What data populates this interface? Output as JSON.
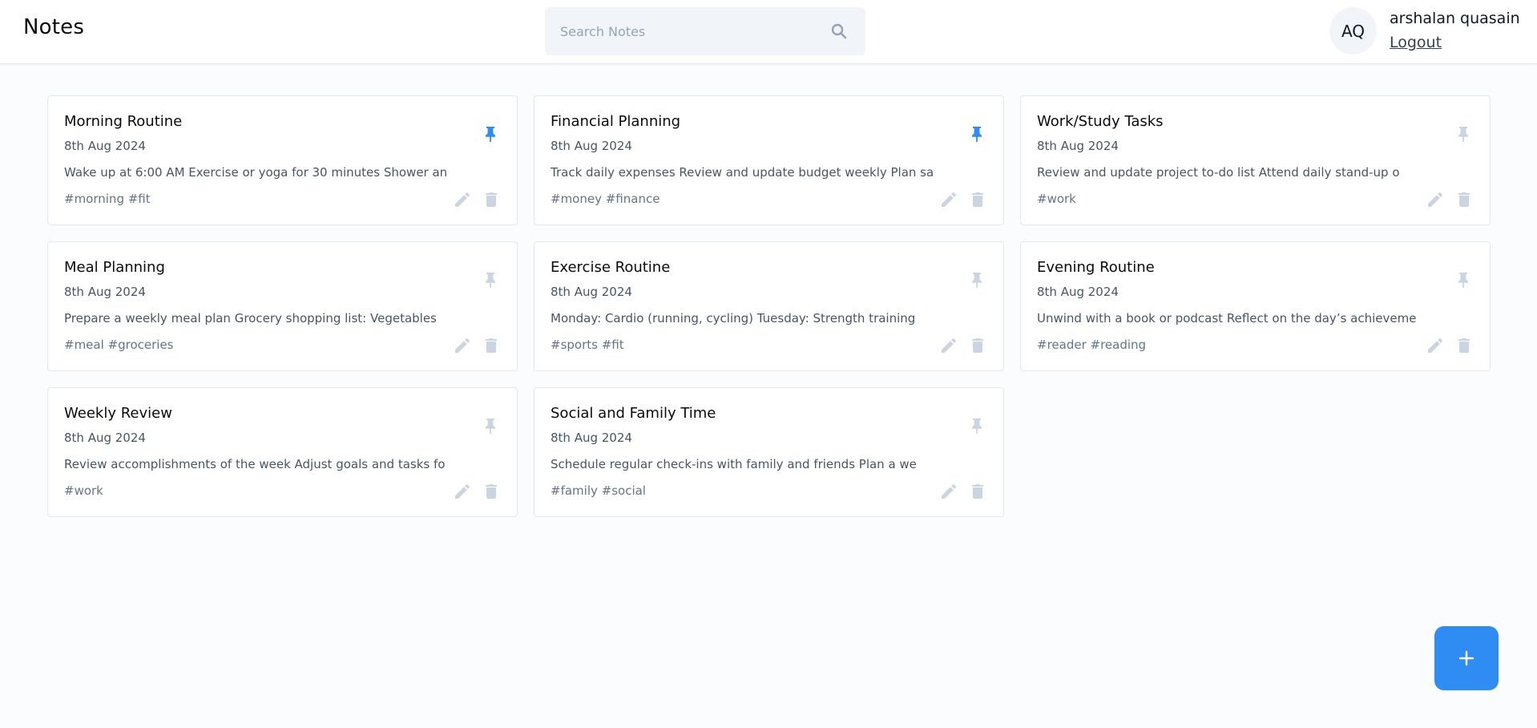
{
  "header": {
    "app_title": "Notes",
    "search_placeholder": "Search Notes",
    "user": {
      "initials": "AQ",
      "name": "arshalan quasain",
      "logout_label": "Logout"
    }
  },
  "colors": {
    "pinned": "#2f8cf2",
    "unpinned": "#cbd5e1",
    "action_icon": "#cbd5e1",
    "fab": "#2f8cf2"
  },
  "notes": [
    {
      "title": "Morning Routine",
      "date": "8th Aug 2024",
      "content": "Wake up at 6:00 AM Exercise or yoga for 30 minutes Shower an",
      "tags": "#morning #fit",
      "pinned": true
    },
    {
      "title": "Financial Planning",
      "date": "8th Aug 2024",
      "content": "Track daily expenses Review and update budget weekly Plan sa",
      "tags": "#money #finance",
      "pinned": true
    },
    {
      "title": "Work/Study Tasks",
      "date": "8th Aug 2024",
      "content": "Review and update project to-do list Attend daily stand-up o",
      "tags": "#work",
      "pinned": false
    },
    {
      "title": "Meal Planning",
      "date": "8th Aug 2024",
      "content": "Prepare a weekly meal plan Grocery shopping list: Vegetables",
      "tags": "#meal #groceries",
      "pinned": false
    },
    {
      "title": "Exercise Routine",
      "date": "8th Aug 2024",
      "content": "Monday: Cardio (running, cycling) Tuesday: Strength training",
      "tags": "#sports #fit",
      "pinned": false
    },
    {
      "title": "Evening Routine",
      "date": "8th Aug 2024",
      "content": "Unwind with a book or podcast Reflect on the day’s achieveme",
      "tags": "#reader #reading",
      "pinned": false
    },
    {
      "title": "Weekly Review",
      "date": "8th Aug 2024",
      "content": "Review accomplishments of the week Adjust goals and tasks fo",
      "tags": "#work",
      "pinned": false
    },
    {
      "title": "Social and Family Time",
      "date": "8th Aug 2024",
      "content": "Schedule regular check-ins with family and friends Plan a we",
      "tags": "#family #social",
      "pinned": false
    }
  ],
  "fab": {
    "icon": "plus-icon"
  }
}
